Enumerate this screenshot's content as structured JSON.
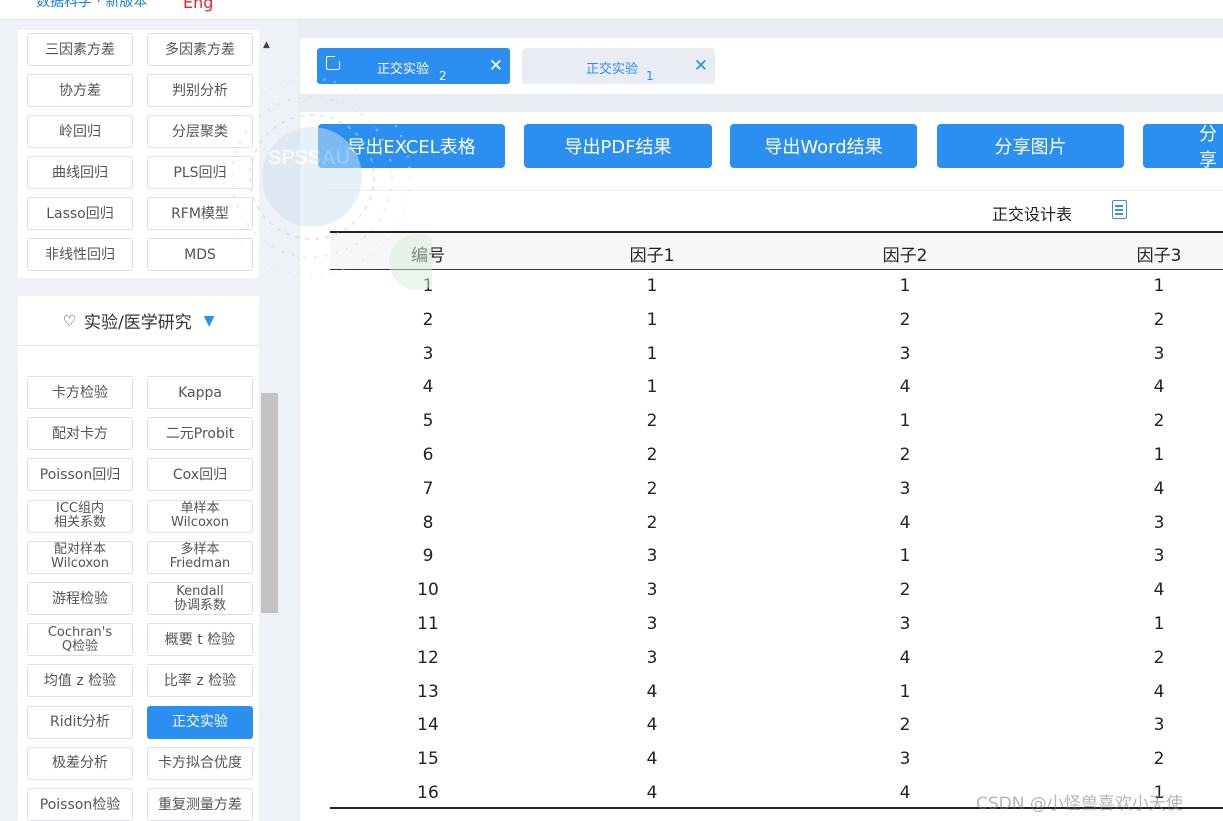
{
  "topbar": {
    "nav_text": "数据科学 · 新版本",
    "lang": "Eng"
  },
  "menu_group1": [
    "三因素方差",
    "多因素方差",
    "协方差",
    "判别分析",
    "岭回归",
    "分层聚类",
    "曲线回归",
    "PLS回归",
    "Lasso回归",
    "RFM模型",
    "非线性回归",
    "MDS"
  ],
  "section2": {
    "title": "实验/医学研究"
  },
  "menu_group2": [
    "卡方检验",
    "Kappa",
    "配对卡方",
    "二元Probit",
    "Poisson回归",
    "Cox回归",
    "ICC组内\n相关系数",
    "单样本\nWilcoxon",
    "配对样本\nWilcoxon",
    "多样本\nFriedman",
    "游程检验",
    "Kendall\n协调系数",
    "Cochran's\nQ检验",
    "概要 t 检验",
    "均值 z 检验",
    "比率 z 检验",
    "Ridit分析",
    "正交实验",
    "极差分析",
    "卡方拟合优度",
    "Poisson检验",
    "重复测量方差"
  ],
  "active_menu": "正交实验",
  "tabs": [
    {
      "label": "正交实验",
      "number": "2"
    },
    {
      "label": "正交实验",
      "number": "1"
    }
  ],
  "actions": [
    "导出EXCEL表格",
    "导出PDF结果",
    "导出Word结果",
    "分享图片",
    "分享"
  ],
  "table": {
    "title": "正交设计表",
    "headers": [
      "编号",
      "因子1",
      "因子2",
      "因子3"
    ],
    "rows": [
      [
        "1",
        "1",
        "1",
        "1"
      ],
      [
        "2",
        "1",
        "2",
        "2"
      ],
      [
        "3",
        "1",
        "3",
        "3"
      ],
      [
        "4",
        "1",
        "4",
        "4"
      ],
      [
        "5",
        "2",
        "1",
        "2"
      ],
      [
        "6",
        "2",
        "2",
        "1"
      ],
      [
        "7",
        "2",
        "3",
        "4"
      ],
      [
        "8",
        "2",
        "4",
        "3"
      ],
      [
        "9",
        "3",
        "1",
        "3"
      ],
      [
        "10",
        "3",
        "2",
        "4"
      ],
      [
        "11",
        "3",
        "3",
        "1"
      ],
      [
        "12",
        "3",
        "4",
        "2"
      ],
      [
        "13",
        "4",
        "1",
        "4"
      ],
      [
        "14",
        "4",
        "2",
        "3"
      ],
      [
        "15",
        "4",
        "3",
        "2"
      ],
      [
        "16",
        "4",
        "4",
        "1"
      ]
    ]
  },
  "watermark": "CSDN @小怪兽喜欢小天使",
  "logo_text": "SPSSAU",
  "colors": {
    "accent": "#2a8ff0",
    "sidebar_bg": "#eef1f5",
    "page_bg": "#e9edf3"
  }
}
